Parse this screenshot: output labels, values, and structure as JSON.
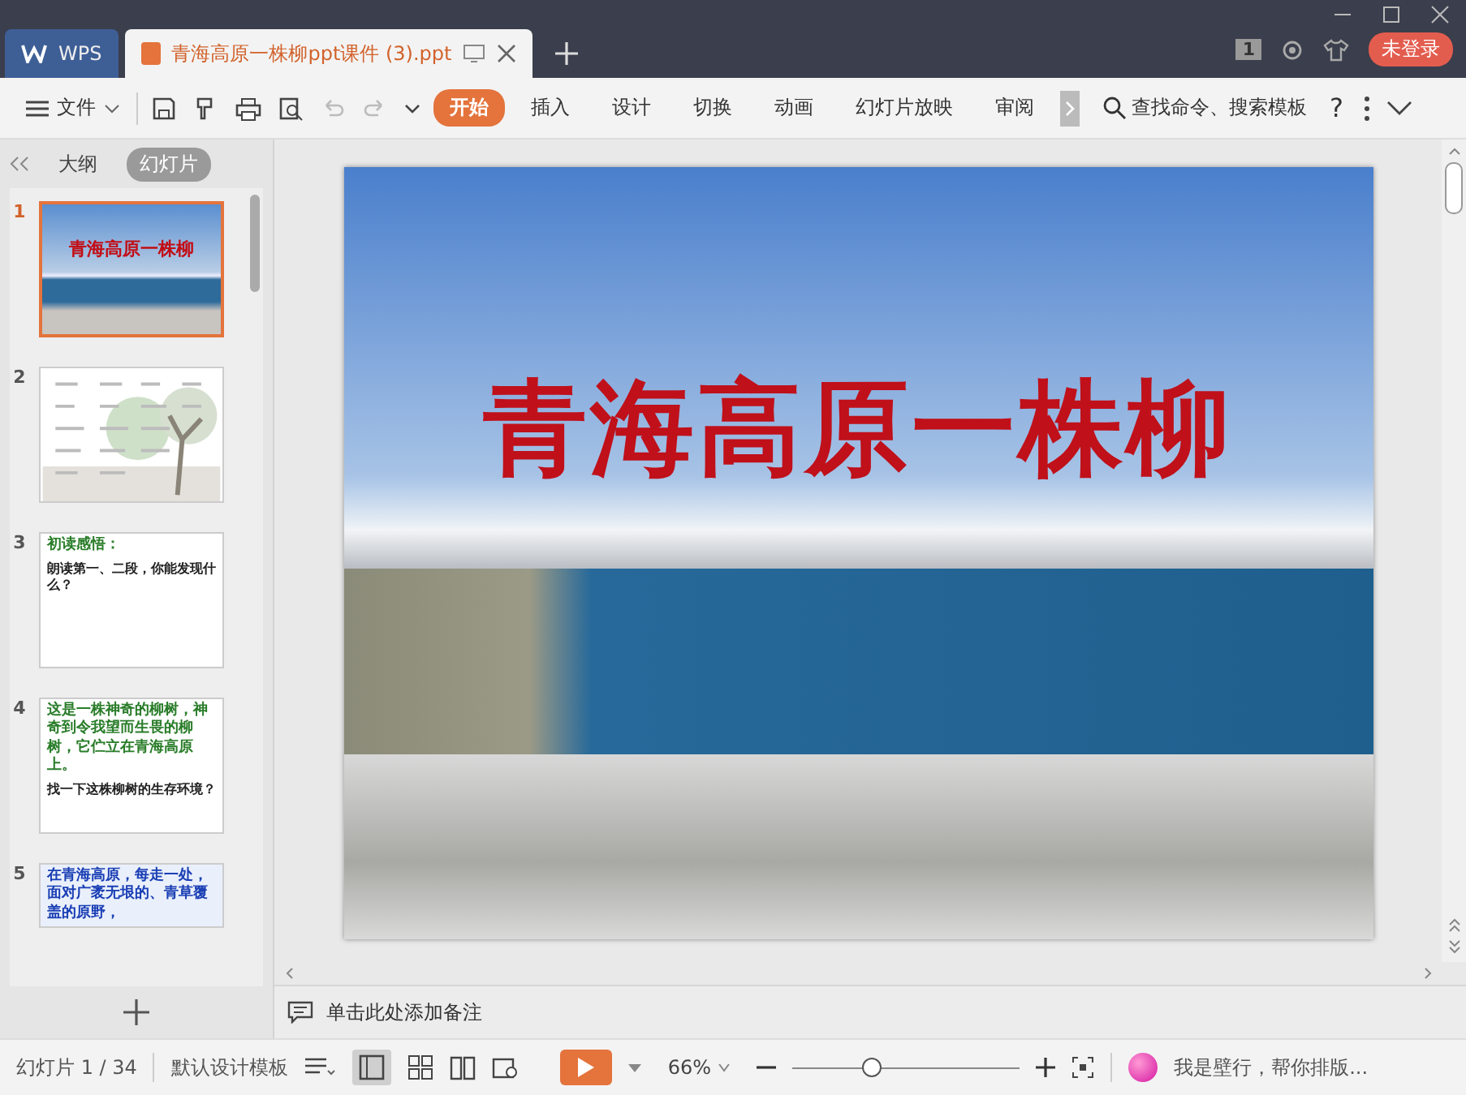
{
  "tabs": [
    {
      "label": "WPS",
      "kind": "home",
      "selected": false
    },
    {
      "label": "青海高原一株柳ppt课件 (3).ppt",
      "kind": "doc",
      "selected": true
    }
  ],
  "account": {
    "badge": "1",
    "login": "未登录"
  },
  "toolbar": {
    "file": "文件",
    "ribbon": [
      {
        "label": "开始",
        "selected": true
      },
      {
        "label": "插入",
        "selected": false
      },
      {
        "label": "设计",
        "selected": false
      },
      {
        "label": "切换",
        "selected": false
      },
      {
        "label": "动画",
        "selected": false
      },
      {
        "label": "幻灯片放映",
        "selected": false
      },
      {
        "label": "审阅",
        "selected": false
      }
    ],
    "search": "查找命令、搜索模板",
    "help": "?"
  },
  "panel": {
    "tabs": [
      {
        "label": "大纲",
        "selected": false
      },
      {
        "label": "幻灯片",
        "selected": true
      }
    ],
    "slides": [
      {
        "number": "1",
        "kind": "title",
        "selected": true,
        "lines": [
          "青海高原一株柳"
        ]
      },
      {
        "number": "2",
        "kind": "picture",
        "selected": false
      },
      {
        "number": "3",
        "kind": "text",
        "selected": false,
        "lines": [
          "初读感悟：",
          "朗读第一、二段，你能发现什么？"
        ]
      },
      {
        "number": "4",
        "kind": "text",
        "selected": false,
        "lines": [
          "这是一株神奇的柳树，神奇到令我望而生畏的柳树，它伫立在青海高原上。",
          "找一下这株柳树的生存环境？"
        ]
      },
      {
        "number": "5",
        "kind": "blue",
        "selected": false,
        "lines": [
          "在青海高原，每走一处，面对广袤无垠的、青草覆盖的原野，"
        ]
      }
    ]
  },
  "slide": {
    "title": "青海高原一株柳"
  },
  "notes": {
    "placeholder": "单击此处添加备注"
  },
  "status_bar": {
    "slide_count": "幻灯片 1 / 34",
    "template": "默认设计模板",
    "zoom": "66%",
    "zoom_slider": {
      "level": 0.35
    },
    "assistant": "我是壁行，帮你排版..."
  }
}
